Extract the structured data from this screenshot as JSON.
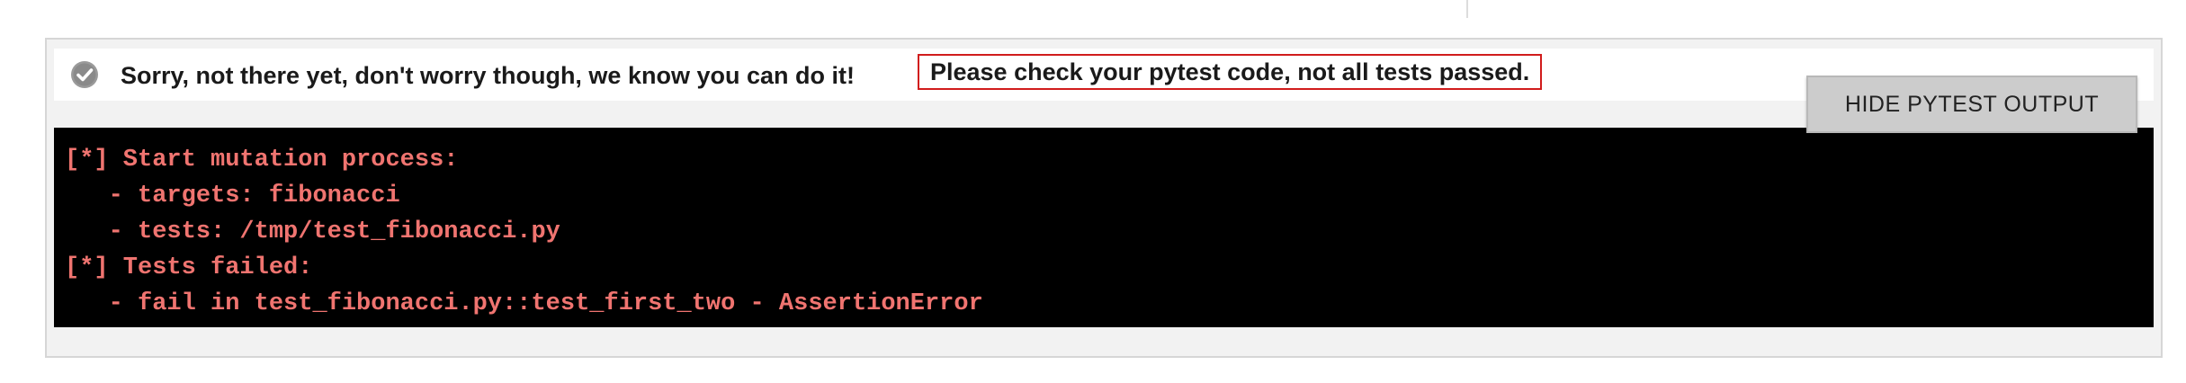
{
  "result": {
    "message": "Sorry, not there yet, don't worry though, we know you can do it!",
    "error": "Please check your pytest code, not all tests passed.",
    "icon": "check-circle-icon",
    "error_color": "#d11c1c"
  },
  "toolbar": {
    "hide_label": "HIDE PYTEST OUTPUT"
  },
  "terminal": {
    "text_color": "#f07470",
    "lines": [
      "[*] Start mutation process:",
      "   - targets: fibonacci",
      "   - tests: /tmp/test_fibonacci.py",
      "[*] Tests failed:",
      "   - fail in test_fibonacci.py::test_first_two - AssertionError"
    ]
  }
}
